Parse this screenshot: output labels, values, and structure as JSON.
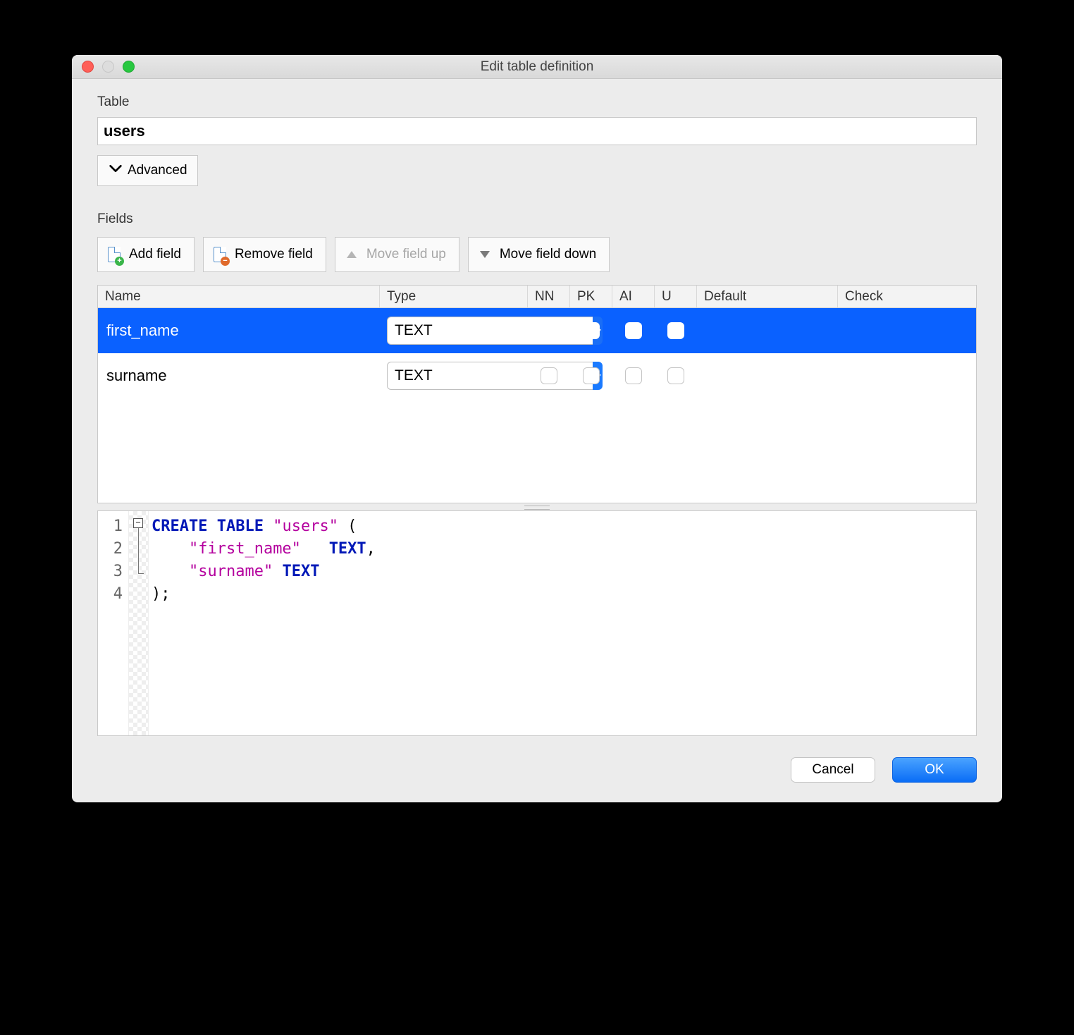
{
  "window": {
    "title": "Edit table definition"
  },
  "labels": {
    "table_section": "Table",
    "advanced": "Advanced",
    "fields_section": "Fields"
  },
  "table": {
    "name": "users"
  },
  "toolbar": {
    "add": "Add field",
    "remove": "Remove field",
    "up": "Move field up",
    "down": "Move field down"
  },
  "columns": {
    "name": "Name",
    "type": "Type",
    "nn": "NN",
    "pk": "PK",
    "ai": "AI",
    "u": "U",
    "default": "Default",
    "check": "Check"
  },
  "rows": [
    {
      "name": "first_name",
      "type": "TEXT",
      "nn": false,
      "pk": false,
      "ai": false,
      "u": false,
      "default": "",
      "check": "",
      "selected": true
    },
    {
      "name": "surname",
      "type": "TEXT",
      "nn": false,
      "pk": false,
      "ai": false,
      "u": false,
      "default": "",
      "check": "",
      "selected": false
    }
  ],
  "sql": {
    "line_numbers": [
      "1",
      "2",
      "3",
      "4"
    ],
    "l1_kw1": "CREATE",
    "l1_kw2": "TABLE",
    "l1_str": "\"users\"",
    "l1_rest": " (",
    "l2_indent": "    ",
    "l2_str": "\"first_name\"",
    "l2_sp": "   ",
    "l2_kw": "TEXT",
    "l2_rest": ",",
    "l3_indent": "    ",
    "l3_str": "\"surname\"",
    "l3_sp": " ",
    "l3_kw": "TEXT",
    "l4": ");"
  },
  "footer": {
    "cancel": "Cancel",
    "ok": "OK"
  }
}
